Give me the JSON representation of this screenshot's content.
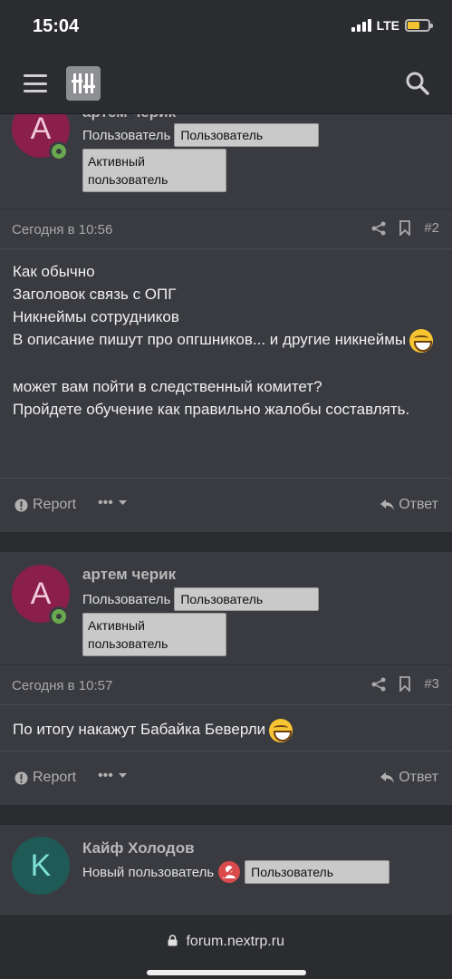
{
  "status": {
    "time": "15:04",
    "network": "LTE"
  },
  "browser": {
    "url": "forum.nextrp.ru"
  },
  "posts": [
    {
      "author": "артем черик",
      "avatar_letter": "A",
      "avatar_color": "#8a1f4b",
      "role": "Пользователь",
      "badge1": "Пользователь",
      "badge2": "Активный пользователь",
      "date": "Сегодня в 10:56",
      "number": "#2",
      "lines": [
        "Как обычно",
        "Заголовок связь с ОПГ",
        "Никнеймы сотрудников",
        "В описание пишут про опгшников... и другие никнеймы",
        "",
        "может вам пойти в следственный комитет?",
        "Пройдете обучение как правильно жалобы составлять."
      ],
      "report": "Report",
      "reply": "Ответ"
    },
    {
      "author": "артем черик",
      "avatar_letter": "A",
      "avatar_color": "#8a1f4b",
      "role": "Пользователь",
      "badge1": "Пользователь",
      "badge2": "Активный пользователь",
      "date": "Сегодня в 10:57",
      "number": "#3",
      "lines": [
        "По итогу накажут Бабайка Беверли"
      ],
      "report": "Report",
      "reply": "Ответ"
    },
    {
      "author": "Кайф Холодов",
      "avatar_letter": "K",
      "avatar_color": "#1f5a57",
      "role": "Новый пользователь",
      "badge1": "Пользователь"
    }
  ],
  "more_label": "•••",
  "icons": [
    "menu-icon",
    "logo-icon",
    "search-icon",
    "share-icon",
    "bookmark-icon",
    "report-icon",
    "reply-icon",
    "lock-icon",
    "user-mute-icon"
  ]
}
